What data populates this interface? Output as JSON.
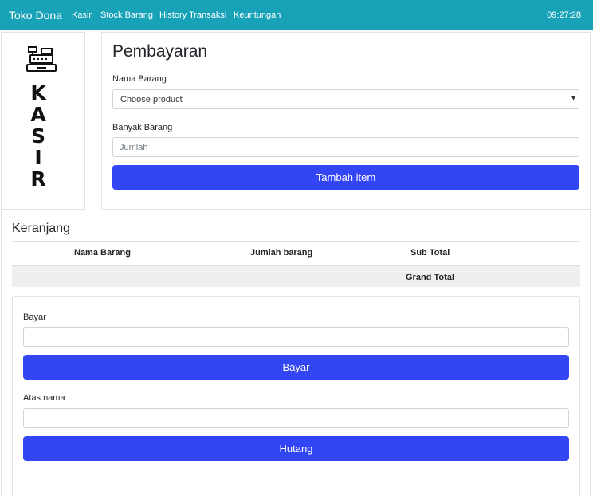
{
  "navbar": {
    "brand": "Toko Dona",
    "links": [
      "Kasir",
      "Stock Barang",
      "History Transaksi",
      "Keuntungan"
    ],
    "clock": "09:27:28",
    "background": "#17a2b8"
  },
  "logo": {
    "icon": "cash-register-icon",
    "letters": [
      "K",
      "A",
      "S",
      "I",
      "R"
    ]
  },
  "payment": {
    "title": "Pembayaran",
    "product_label": "Nama Barang",
    "product_select_value": "Choose product",
    "quantity_label": "Banyak Barang",
    "quantity_placeholder": "Jumlah",
    "add_button": "Tambah item"
  },
  "cart": {
    "title": "Keranjang",
    "columns": [
      "Nama Barang",
      "Jumlah barang",
      "Sub Total"
    ],
    "grand_total_label": "Grand Total",
    "pay_label": "Bayar",
    "pay_button": "Bayar",
    "name_label": "Atas nama",
    "debt_button": "Hutang"
  },
  "colors": {
    "primary_button": "#3346f6",
    "navbar": "#17a2b8"
  }
}
